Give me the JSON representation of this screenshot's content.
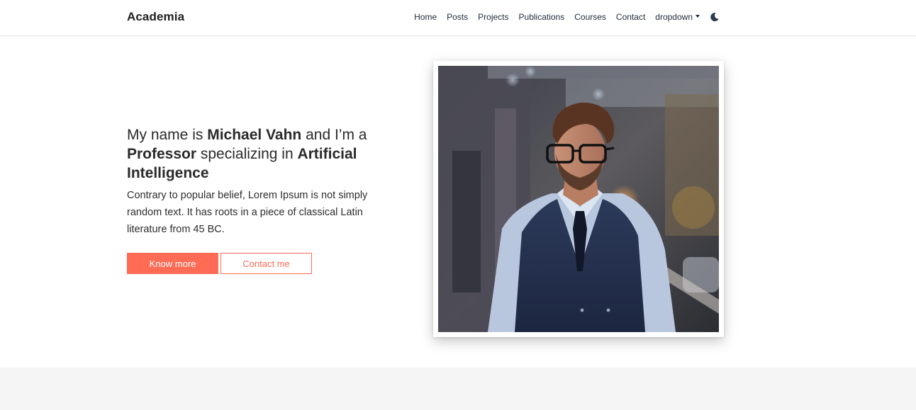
{
  "navbar": {
    "brand": "Academia",
    "links": [
      {
        "label": "Home"
      },
      {
        "label": "Posts"
      },
      {
        "label": "Projects"
      },
      {
        "label": "Publications"
      },
      {
        "label": "Courses"
      },
      {
        "label": "Contact"
      }
    ],
    "dropdown_label": "dropdown",
    "theme_toggle_icon": "moon-icon"
  },
  "hero": {
    "headline": {
      "part1": "My name is ",
      "name": "Michael Vahn",
      "part2": " and I’m a ",
      "role": "Professor",
      "part3": " specializing in ",
      "field": "Artificial Intelligence"
    },
    "description": "Contrary to popular belief, Lorem Ipsum is not simply random text. It has roots in a piece of classical Latin literature from 45 BC.",
    "primary_button": "Know more",
    "secondary_button": "Contact me"
  },
  "colors": {
    "accent": "#ff6b55",
    "nav_text": "#1f2b3a",
    "bottom_band": "#f5f5f5"
  }
}
